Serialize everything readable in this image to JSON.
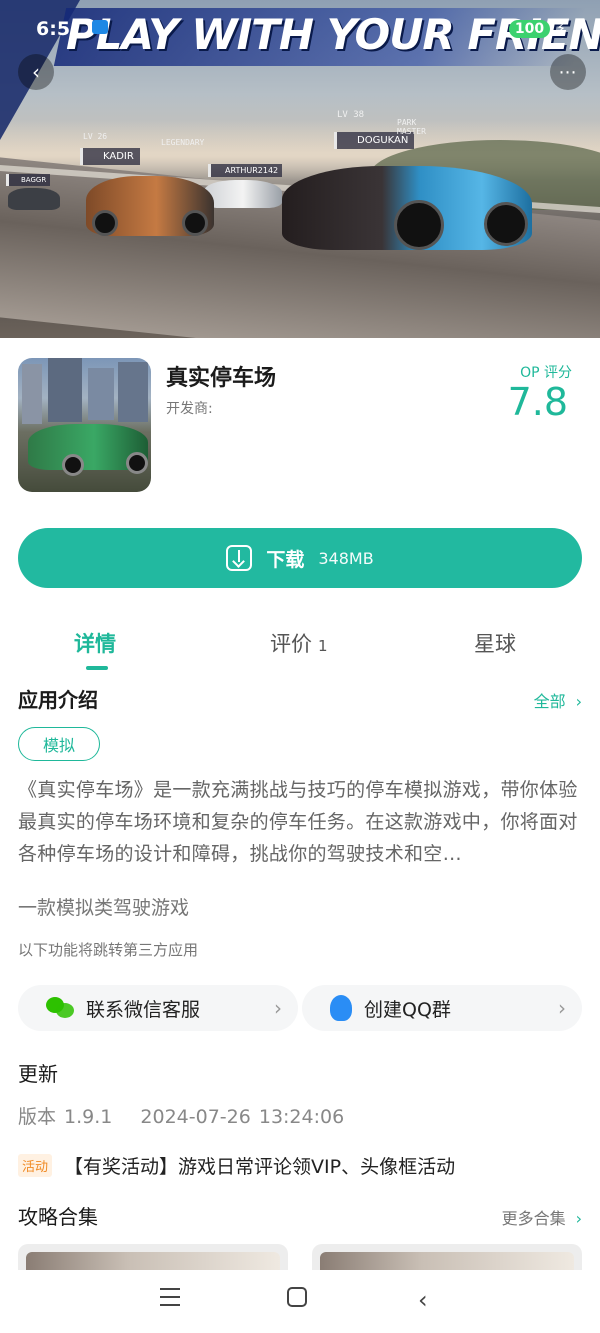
{
  "status_bar": {
    "time": "6:5",
    "battery": "100"
  },
  "hero": {
    "banner_text": "PLAY WITH YOUR FRIENDS!",
    "players": [
      {
        "level": "LV 38",
        "rank": "PARK MASTER",
        "name": "DOGUKAN"
      },
      {
        "level": "LV 26",
        "rank": "LEGENDARY",
        "name": "KADIR"
      },
      {
        "level": "",
        "rank": "",
        "name": "ARTHUR2142"
      },
      {
        "level": "",
        "rank": "",
        "name": "BAGGR"
      }
    ]
  },
  "app": {
    "title": "真实停车场",
    "developer_label": "开发商:",
    "score_label": "OP 评分",
    "score": "7.8"
  },
  "download": {
    "label": "下载",
    "size": "348MB"
  },
  "tabs": [
    {
      "label": "详情",
      "count": ""
    },
    {
      "label": "评价",
      "count": "1"
    },
    {
      "label": "星球",
      "count": ""
    }
  ],
  "intro": {
    "title": "应用介绍",
    "all_link": "全部",
    "tag": "模拟",
    "description": "《真实停车场》是一款充满挑战与技巧的停车模拟游戏，带你体验最真实的停车场环境和复杂的停车任务。在这款游戏中，你将面对各种停车场的设计和障碍，挑战你的驾驶技术和空…",
    "subtitle": "一款模拟类驾驶游戏",
    "third_party_note": "以下功能将跳转第三方应用"
  },
  "external": {
    "wechat_label": "联系微信客服",
    "qq_label": "创建QQ群"
  },
  "update": {
    "title": "更新",
    "version": "版本 1.9.1",
    "datetime": "2024-07-26 13:24:06"
  },
  "activity": {
    "badge": "活动",
    "text": "【有奖活动】游戏日常评论领VIP、头像框活动"
  },
  "guides": {
    "title": "攻略合集",
    "more_link": "更多合集"
  },
  "colors": {
    "accent": "#22b9a0",
    "activity": "#f08a24"
  }
}
